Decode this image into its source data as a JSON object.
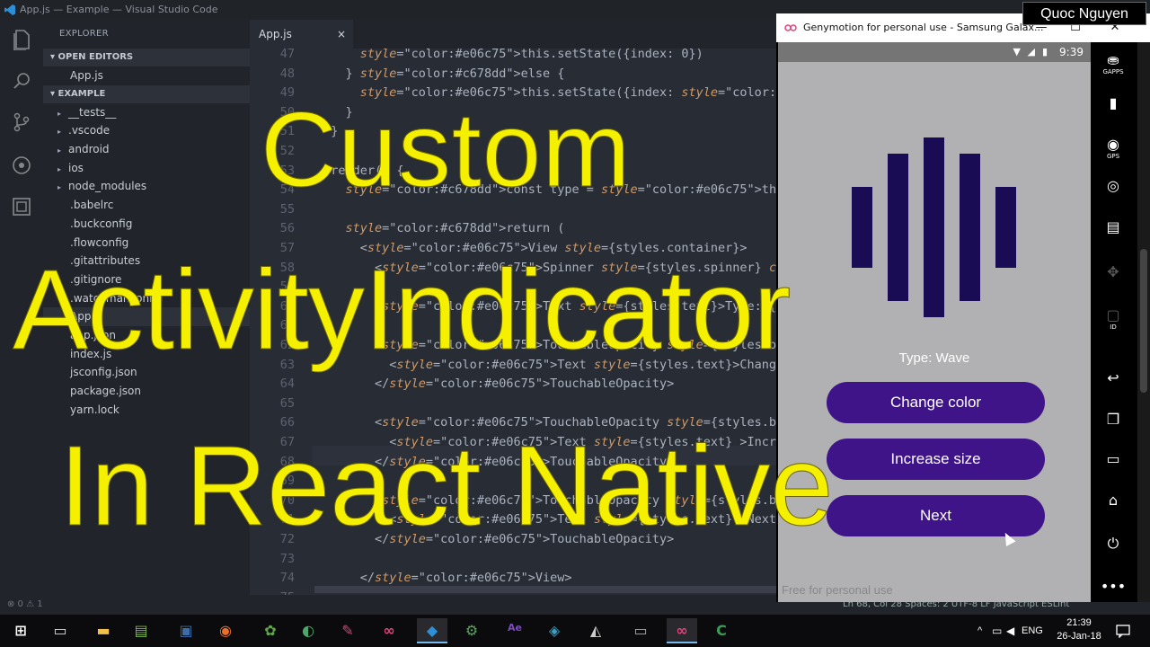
{
  "vscode": {
    "window_title": "App.js — Example — Visual Studio Code",
    "explorer_header": "EXPLORER",
    "open_editors_header": "OPEN EDITORS",
    "open_editors": [
      "App.js"
    ],
    "project_header": "EXAMPLE",
    "tree": [
      {
        "label": "__tests__",
        "folder": true
      },
      {
        "label": ".vscode",
        "folder": true
      },
      {
        "label": "android",
        "folder": true
      },
      {
        "label": "ios",
        "folder": true
      },
      {
        "label": "node_modules",
        "folder": true
      },
      {
        "label": ".babelrc",
        "folder": false
      },
      {
        "label": ".buckconfig",
        "folder": false
      },
      {
        "label": ".flowconfig",
        "folder": false
      },
      {
        "label": ".gitattributes",
        "folder": false
      },
      {
        "label": ".gitignore",
        "folder": false
      },
      {
        "label": ".watchmanconfig",
        "folder": false
      },
      {
        "label": "App.js",
        "folder": false,
        "selected": true
      },
      {
        "label": "app.json",
        "folder": false
      },
      {
        "label": "index.js",
        "folder": false
      },
      {
        "label": "jsconfig.json",
        "folder": false
      },
      {
        "label": "package.json",
        "folder": false
      },
      {
        "label": "yarn.lock",
        "folder": false
      }
    ],
    "tab_label": "App.js",
    "tab_close": "×",
    "code_lines": [
      {
        "n": "47",
        "text": "      this.setState({index: 0})"
      },
      {
        "n": "48",
        "text": "    } else {"
      },
      {
        "n": "49",
        "text": "      this.setState({index: this.state.index ++})"
      },
      {
        "n": "50",
        "text": "    }"
      },
      {
        "n": "51",
        "text": "  }"
      },
      {
        "n": "52",
        "text": ""
      },
      {
        "n": "53",
        "text": "  render() {"
      },
      {
        "n": "54",
        "text": "    const type = this.state.types[this.state.index]"
      },
      {
        "n": "55",
        "text": ""
      },
      {
        "n": "56",
        "text": "    return ("
      },
      {
        "n": "57",
        "text": "      <View style={styles.container}>"
      },
      {
        "n": "58",
        "text": "        <Spinner style={styles.spinner} color={this.state.c"
      },
      {
        "n": "59",
        "text": ""
      },
      {
        "n": "60",
        "text": "        <Text style={styles.text}>Type: {type}</Text>"
      },
      {
        "n": "61",
        "text": ""
      },
      {
        "n": "62",
        "text": "        <TouchableOpacity style={styles.button} onPress={th"
      },
      {
        "n": "63",
        "text": "          <Text style={styles.text}>Change color</Text>"
      },
      {
        "n": "64",
        "text": "        </TouchableOpacity>"
      },
      {
        "n": "65",
        "text": ""
      },
      {
        "n": "66",
        "text": "        <TouchableOpacity style={styles.button} onPress={th"
      },
      {
        "n": "67",
        "text": "          <Text style={styles.text} >Increase size</Text>"
      },
      {
        "n": "68",
        "text": "        </TouchableOpacity>"
      },
      {
        "n": "69",
        "text": ""
      },
      {
        "n": "70",
        "text": "        <TouchableOpacity style={styles.button} onPress={th"
      },
      {
        "n": "71",
        "text": "          <Text style={styles.text} >Next</Text>"
      },
      {
        "n": "72",
        "text": "        </TouchableOpacity>"
      },
      {
        "n": "73",
        "text": ""
      },
      {
        "n": "74",
        "text": "      </View>"
      },
      {
        "n": "75",
        "text": ""
      }
    ],
    "status_left": "⊗ 0  ⚠ 1",
    "status_right": "Ln 68, Col 28    Spaces: 2    UTF-8    LF    JavaScript    ESLint"
  },
  "genymotion": {
    "window_title": "Genymotion for personal use - Samsung Galax...",
    "window_controls": [
      "—",
      "☐",
      "✕"
    ],
    "status_time": "9:39",
    "type_label": "Type: Wave",
    "wave_levels": [
      0.45,
      0.82,
      1.0,
      0.82,
      0.45
    ],
    "buttons": [
      "Change color",
      "Increase size",
      "Next"
    ],
    "watermark": "Free for personal use",
    "side_tools": [
      {
        "icon": "gapps-icon",
        "label": "GAPPS"
      },
      {
        "icon": "battery-icon",
        "label": ""
      },
      {
        "icon": "gps-icon",
        "label": "GPS"
      },
      {
        "icon": "webcam-icon",
        "label": ""
      },
      {
        "icon": "clapper-icon",
        "label": ""
      },
      {
        "icon": "move-icon",
        "label": ""
      },
      {
        "icon": "id-icon",
        "label": "ID"
      },
      {
        "icon": "back-icon",
        "label": ""
      },
      {
        "icon": "recent-apps-icon",
        "label": ""
      },
      {
        "icon": "menu-icon",
        "label": ""
      },
      {
        "icon": "home-icon",
        "label": ""
      },
      {
        "icon": "power-icon",
        "label": ""
      },
      {
        "icon": "more-icon",
        "label": ""
      }
    ]
  },
  "presenter": "Quoc Nguyen",
  "overlay_title": {
    "line1": "Custom",
    "line2": "ActivityIndicator",
    "line3": "In React Native",
    "color": "#f4f000"
  },
  "taskbar": {
    "language": "ENG",
    "time": "21:39",
    "date": "26-Jan-18",
    "apps": [
      "start-icon",
      "task-view-icon",
      "file-explorer-icon",
      "notepad-icon",
      "virtualbox-icon",
      "firefox-icon",
      "scene-builder-icon",
      "chat-icon",
      "paint-icon",
      "genymotion-icon",
      "vscode-icon",
      "android-studio-icon",
      "after-effects-icon",
      "layers-icon",
      "unity-icon",
      "terminal-icon",
      "genymotion-device-icon",
      "camtasia-icon"
    ]
  }
}
